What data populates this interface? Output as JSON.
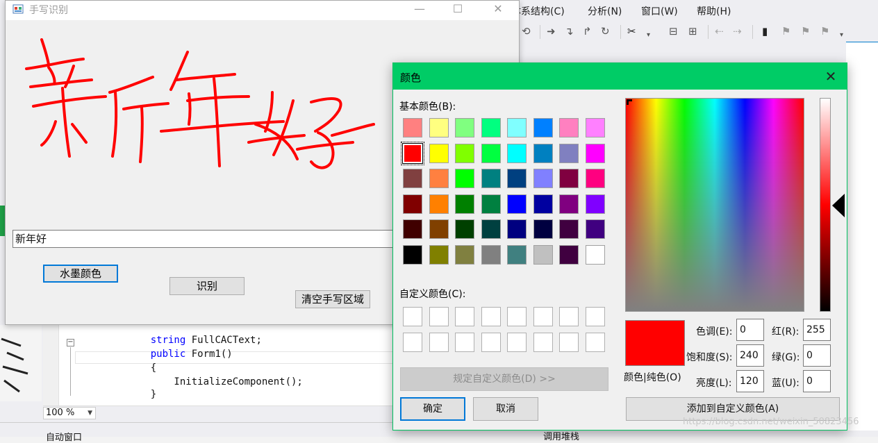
{
  "vs": {
    "menu": [
      "体系结构(C)",
      "分析(N)",
      "窗口(W)",
      "帮助(H)"
    ],
    "code_lines": [
      {
        "kw": "string",
        "rest": " FullCACText;"
      },
      {
        "kw": "public",
        "rest": " Form1()"
      },
      {
        "kw": "",
        "rest": "{"
      },
      {
        "kw": "",
        "rest": "    InitializeComponent();"
      },
      {
        "kw": "",
        "rest": "}"
      }
    ],
    "zoom": "100 %",
    "bottom_left": "自动窗口",
    "bottom_right": "调用堆栈"
  },
  "hw_window": {
    "title": "手写识别",
    "ink_color": "#ff0000",
    "recognized_text": "新年好",
    "btn_ink_color": "水墨颜色",
    "btn_recognize": "识别",
    "btn_clear": "清空手写区域"
  },
  "color_dialog": {
    "title": "颜色",
    "basic_label": "基本颜色(B):",
    "basic_colors": [
      [
        "#ff8080",
        "#ffff80",
        "#80ff80",
        "#00ff80",
        "#80ffff",
        "#0080ff",
        "#ff80c0",
        "#ff80ff"
      ],
      [
        "#ff0000",
        "#ffff00",
        "#80ff00",
        "#00ff40",
        "#00ffff",
        "#0080c0",
        "#8080c0",
        "#ff00ff"
      ],
      [
        "#804040",
        "#ff8040",
        "#00ff00",
        "#008080",
        "#004080",
        "#8080ff",
        "#800040",
        "#ff0080"
      ],
      [
        "#800000",
        "#ff8000",
        "#008000",
        "#008040",
        "#0000ff",
        "#0000a0",
        "#800080",
        "#8000ff"
      ],
      [
        "#400000",
        "#804000",
        "#004000",
        "#004040",
        "#000080",
        "#000040",
        "#400040",
        "#400080"
      ],
      [
        "#000000",
        "#808000",
        "#808040",
        "#808080",
        "#408080",
        "#c0c0c0",
        "#400040",
        "#ffffff"
      ]
    ],
    "selected_row": 1,
    "selected_col": 0,
    "custom_label": "自定义颜色(C):",
    "btn_define": "规定自定义颜色(D) >>",
    "btn_ok": "确定",
    "btn_cancel": "取消",
    "preview_label": "颜色|纯色(O)",
    "preview_color": "#ff0000",
    "fields": {
      "hue_label": "色调(E):",
      "hue": "0",
      "sat_label": "饱和度(S):",
      "sat": "240",
      "lum_label": "亮度(L):",
      "lum": "120",
      "red_label": "红(R):",
      "red": "255",
      "green_label": "绿(G):",
      "green": "0",
      "blue_label": "蓝(U):",
      "blue": "0"
    },
    "btn_add": "添加到自定义颜色(A)"
  },
  "watermark": "https://blog.csdn.net/weixin_50823456"
}
